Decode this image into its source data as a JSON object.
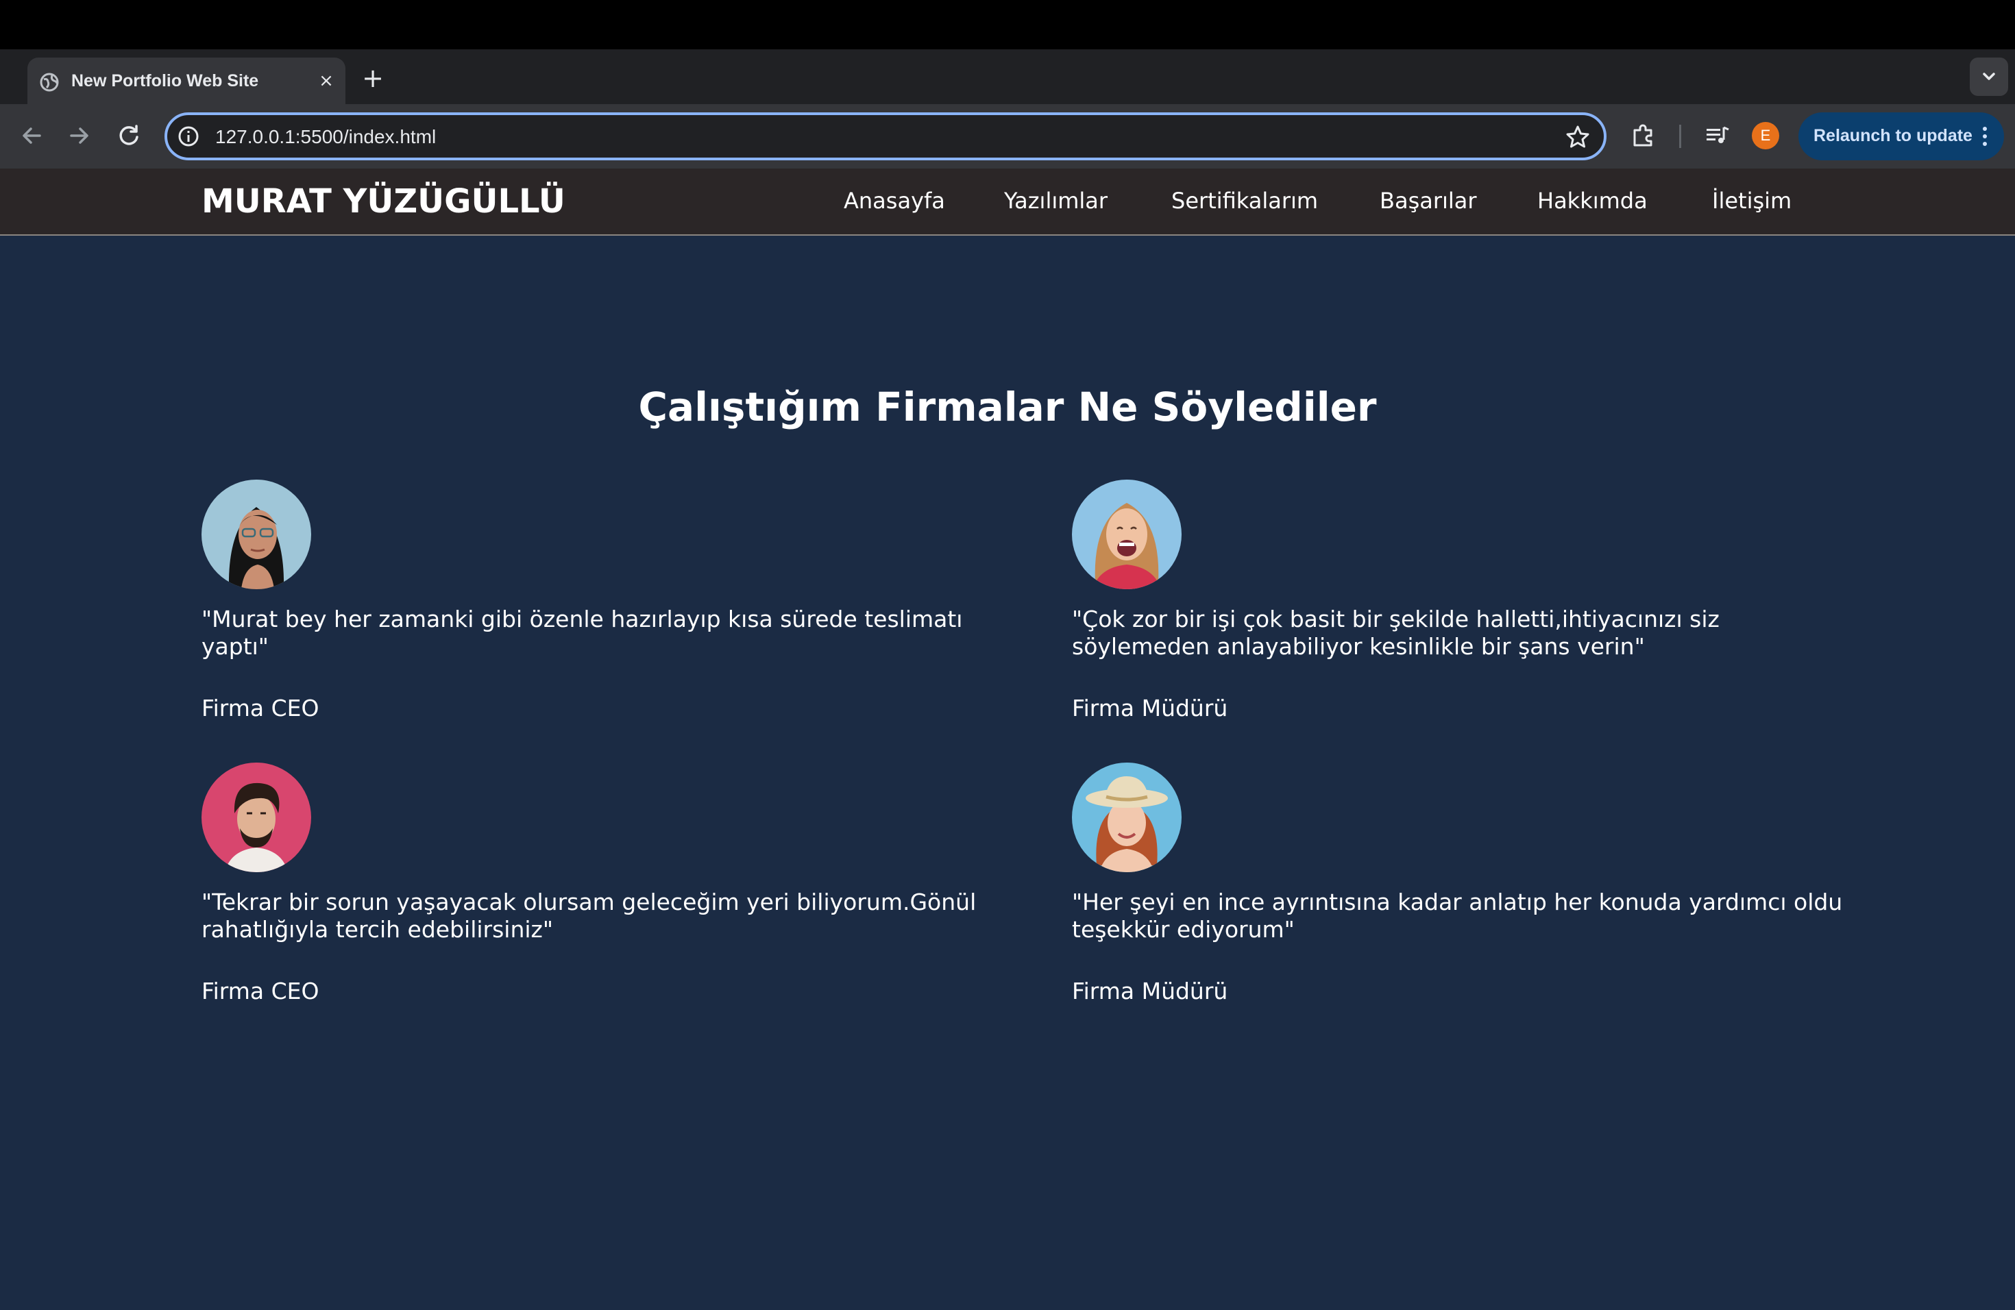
{
  "browser": {
    "tab_title": "New Portfolio Web Site",
    "tab_close": "×",
    "new_tab": "+",
    "url": "127.0.0.1:5500/index.html",
    "profile_initial": "E",
    "relaunch_label": "Relaunch to update"
  },
  "site": {
    "logo": "MURAT YÜZÜGÜLLÜ",
    "nav": [
      "Anasayfa",
      "Yazılımlar",
      "Sertifikalarım",
      "Başarılar",
      "Hakkımda",
      "İletişim"
    ]
  },
  "section": {
    "title": "Çalıştığım Firmalar Ne Söylediler"
  },
  "testimonials": [
    {
      "quote": "\"Murat bey her zamanki gibi özenle hazırlayıp kısa sürede teslimatı yaptı\"",
      "role": "Firma CEO",
      "avatar_colors": {
        "bg": "#9fc6d8",
        "hair": "#141414",
        "skin": "#c98f72"
      }
    },
    {
      "quote": "\"Çok zor bir işi çok basit bir şekilde halletti,ihtiyacınızı siz söylemeden anlayabiliyor kesinlikle bir şans verin\"",
      "role": "Firma Müdürü",
      "avatar_colors": {
        "bg": "#8fc4e6",
        "hair": "#c58a52",
        "skin": "#f0c2a2"
      }
    },
    {
      "quote": "\"Tekrar bir sorun yaşayacak olursam geleceğim yeri biliyorum.Gönül rahatlığıyla tercih edebilirsiniz\"",
      "role": "Firma CEO",
      "avatar_colors": {
        "bg": "#d8466e",
        "hair": "#2a1c16",
        "skin": "#e0b294"
      }
    },
    {
      "quote": "\"Her şeyi en ince ayrıntısına kadar anlatıp her konuda yardımcı oldu teşekkür ediyorum\"",
      "role": "Firma Müdürü",
      "avatar_colors": {
        "bg": "#6fbde0",
        "hair": "#b5532b",
        "skin": "#f2c8ae"
      }
    }
  ]
}
